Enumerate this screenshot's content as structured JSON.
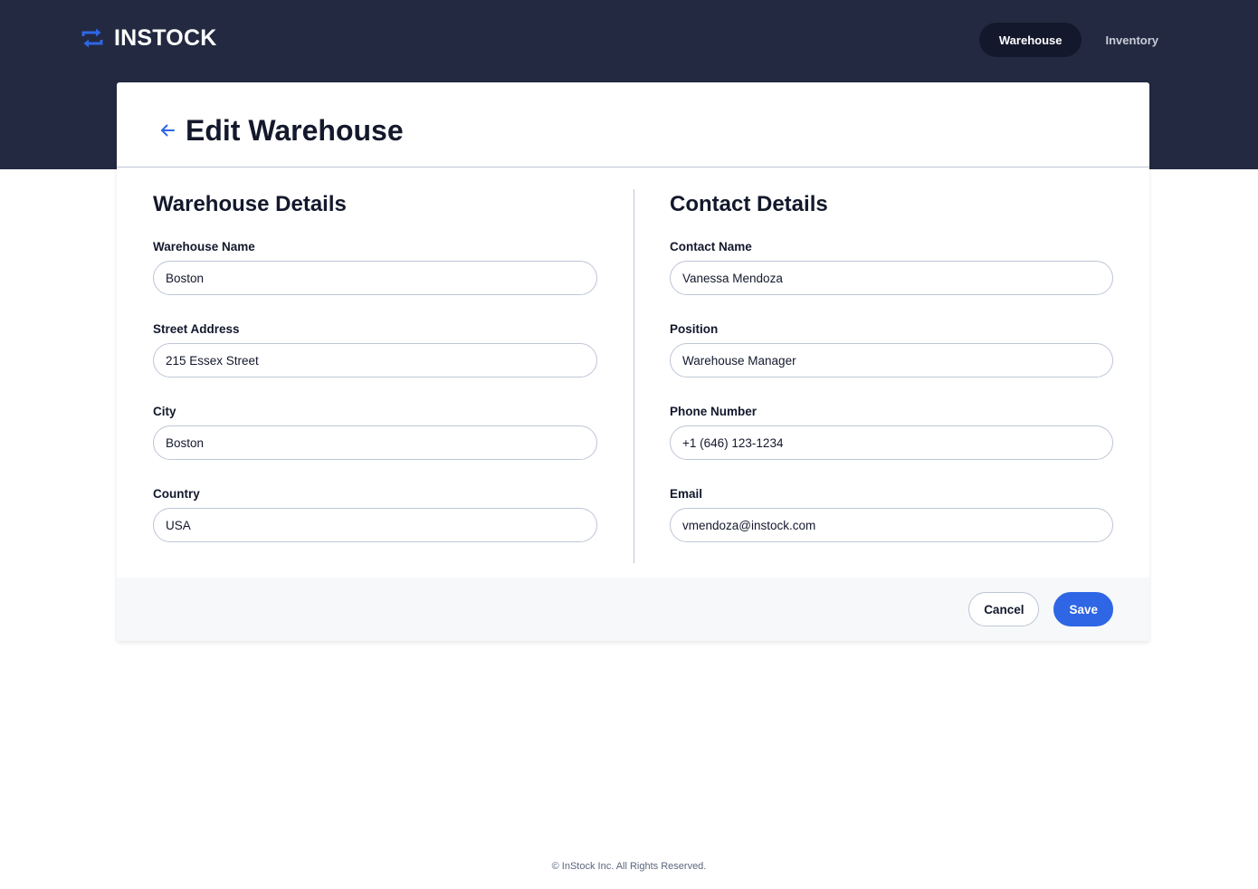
{
  "brand": {
    "name": "INSTOCK",
    "accent": "#2E66E5",
    "header_bg": "#232940"
  },
  "nav": {
    "items": [
      {
        "label": "Warehouse",
        "active": true
      },
      {
        "label": "Inventory",
        "active": false
      }
    ]
  },
  "page": {
    "title": "Edit Warehouse",
    "back_icon": "arrow-left-icon"
  },
  "warehouse_details": {
    "title": "Warehouse Details",
    "fields": [
      {
        "label": "Warehouse Name",
        "value": "Boston"
      },
      {
        "label": "Street Address",
        "value": "215 Essex Street"
      },
      {
        "label": "City",
        "value": "Boston"
      },
      {
        "label": "Country",
        "value": "USA"
      }
    ]
  },
  "contact_details": {
    "title": "Contact Details",
    "fields": [
      {
        "label": "Contact Name",
        "value": "Vanessa Mendoza"
      },
      {
        "label": "Position",
        "value": "Warehouse Manager"
      },
      {
        "label": "Phone Number",
        "value": "+1 (646) 123-1234"
      },
      {
        "label": "Email",
        "value": "vmendoza@instock.com"
      }
    ]
  },
  "actions": {
    "cancel_label": "Cancel",
    "save_label": "Save"
  },
  "footer": {
    "copyright": "© InStock Inc. All Rights Reserved."
  }
}
